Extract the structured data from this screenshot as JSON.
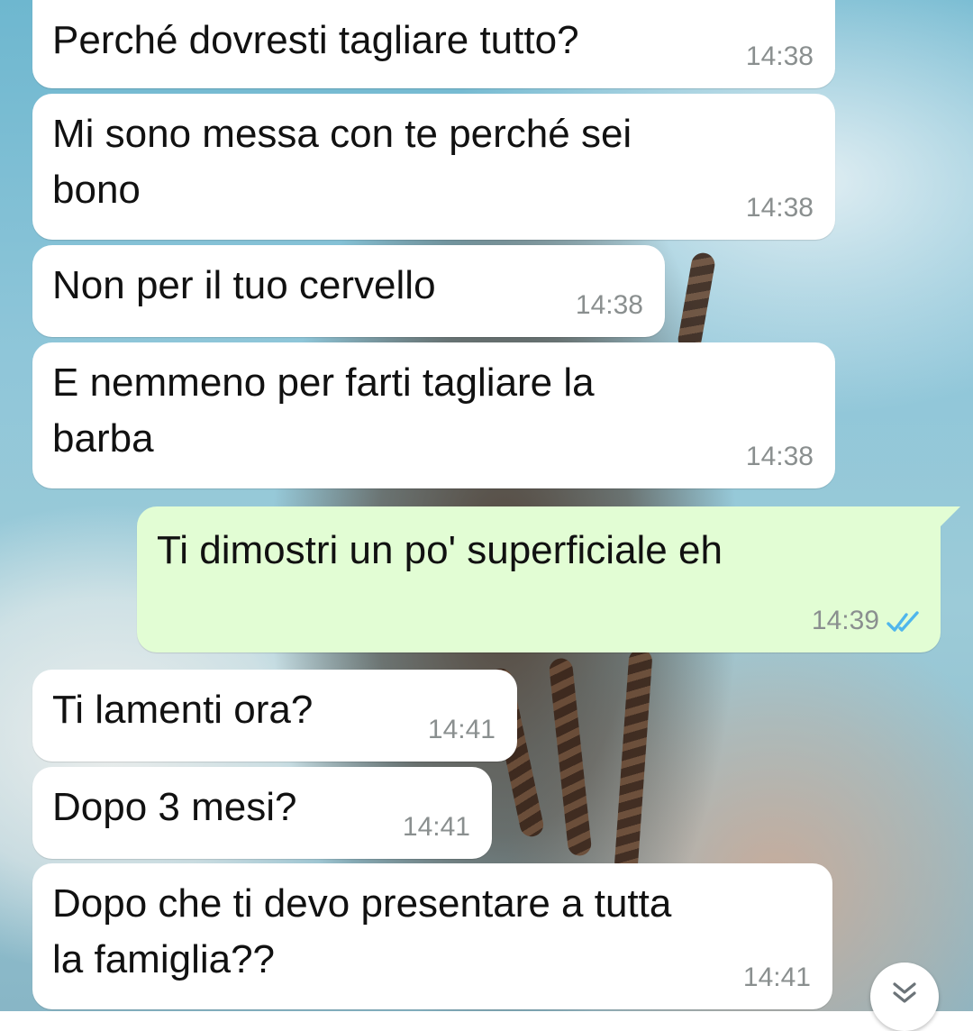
{
  "messages": [
    {
      "direction": "in",
      "text": "Perché dovresti tagliare tutto?",
      "time": "14:38"
    },
    {
      "direction": "in",
      "text": "Mi sono messa con te perché sei\nbono",
      "time": "14:38"
    },
    {
      "direction": "in",
      "text": "Non per il tuo cervello",
      "time": "14:38"
    },
    {
      "direction": "in",
      "text": "E nemmeno per farti tagliare la\nbarba",
      "time": "14:38"
    },
    {
      "direction": "out",
      "text": "Ti dimostri un po' superficiale eh",
      "time": "14:39",
      "status": "read"
    },
    {
      "direction": "in",
      "text": "Ti lamenti ora?",
      "time": "14:41"
    },
    {
      "direction": "in",
      "text": "Dopo 3 mesi?",
      "time": "14:41"
    },
    {
      "direction": "in",
      "text": "Dopo che ti devo presentare a tutta\nla famiglia??",
      "time": "14:41"
    }
  ],
  "colors": {
    "incoming_bubble": "#ffffff",
    "outgoing_bubble": "#e2fdd4",
    "read_ticks": "#4fb6ec",
    "timestamp": "#8a8f8f"
  },
  "icons": {
    "read_receipt": "double-check-icon",
    "scroll_down": "double-chevron-down-icon"
  }
}
